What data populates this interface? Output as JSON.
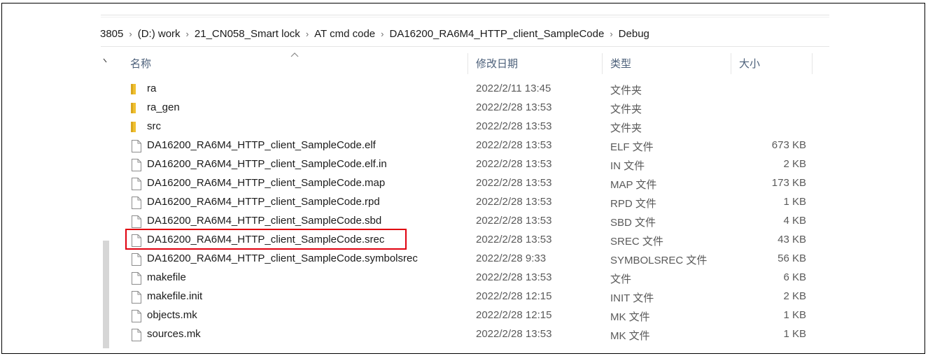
{
  "breadcrumb": {
    "items": [
      "3805",
      "(D:) work",
      "21_CN058_Smart lock",
      "AT cmd code",
      "DA16200_RA6M4_HTTP_client_SampleCode",
      "Debug"
    ],
    "separator": "›"
  },
  "columns": {
    "name": "名称",
    "date": "修改日期",
    "type": "类型",
    "size": "大小"
  },
  "files": [
    {
      "name": "ra",
      "date": "2022/2/11 13:45",
      "type": "文件夹",
      "size": "",
      "icon": "folder-icon"
    },
    {
      "name": "ra_gen",
      "date": "2022/2/28 13:53",
      "type": "文件夹",
      "size": "",
      "icon": "folder-icon"
    },
    {
      "name": "src",
      "date": "2022/2/28 13:53",
      "type": "文件夹",
      "size": "",
      "icon": "folder-icon"
    },
    {
      "name": "DA16200_RA6M4_HTTP_client_SampleCode.elf",
      "date": "2022/2/28 13:53",
      "type": "ELF 文件",
      "size": "673 KB",
      "icon": "file-icon"
    },
    {
      "name": "DA16200_RA6M4_HTTP_client_SampleCode.elf.in",
      "date": "2022/2/28 13:53",
      "type": "IN 文件",
      "size": "2 KB",
      "icon": "file-icon"
    },
    {
      "name": "DA16200_RA6M4_HTTP_client_SampleCode.map",
      "date": "2022/2/28 13:53",
      "type": "MAP 文件",
      "size": "173 KB",
      "icon": "file-icon"
    },
    {
      "name": "DA16200_RA6M4_HTTP_client_SampleCode.rpd",
      "date": "2022/2/28 13:53",
      "type": "RPD 文件",
      "size": "1 KB",
      "icon": "file-icon"
    },
    {
      "name": "DA16200_RA6M4_HTTP_client_SampleCode.sbd",
      "date": "2022/2/28 13:53",
      "type": "SBD 文件",
      "size": "4 KB",
      "icon": "file-icon"
    },
    {
      "name": "DA16200_RA6M4_HTTP_client_SampleCode.srec",
      "date": "2022/2/28 13:53",
      "type": "SREC 文件",
      "size": "43 KB",
      "icon": "file-icon",
      "highlighted": true
    },
    {
      "name": "DA16200_RA6M4_HTTP_client_SampleCode.symbolsrec",
      "date": "2022/2/28 9:33",
      "type": "SYMBOLSREC 文件",
      "size": "56 KB",
      "icon": "file-icon"
    },
    {
      "name": "makefile",
      "date": "2022/2/28 13:53",
      "type": "文件",
      "size": "6 KB",
      "icon": "file-icon"
    },
    {
      "name": "makefile.init",
      "date": "2022/2/28 12:15",
      "type": "INIT 文件",
      "size": "2 KB",
      "icon": "file-icon"
    },
    {
      "name": "objects.mk",
      "date": "2022/2/28 12:15",
      "type": "MK 文件",
      "size": "1 KB",
      "icon": "file-icon"
    },
    {
      "name": "sources.mk",
      "date": "2022/2/28 13:53",
      "type": "MK 文件",
      "size": "1 KB",
      "icon": "file-icon"
    }
  ],
  "colors": {
    "folder": "#f0c02f",
    "header_text": "#4c607a",
    "highlight_border": "#e0000f"
  }
}
